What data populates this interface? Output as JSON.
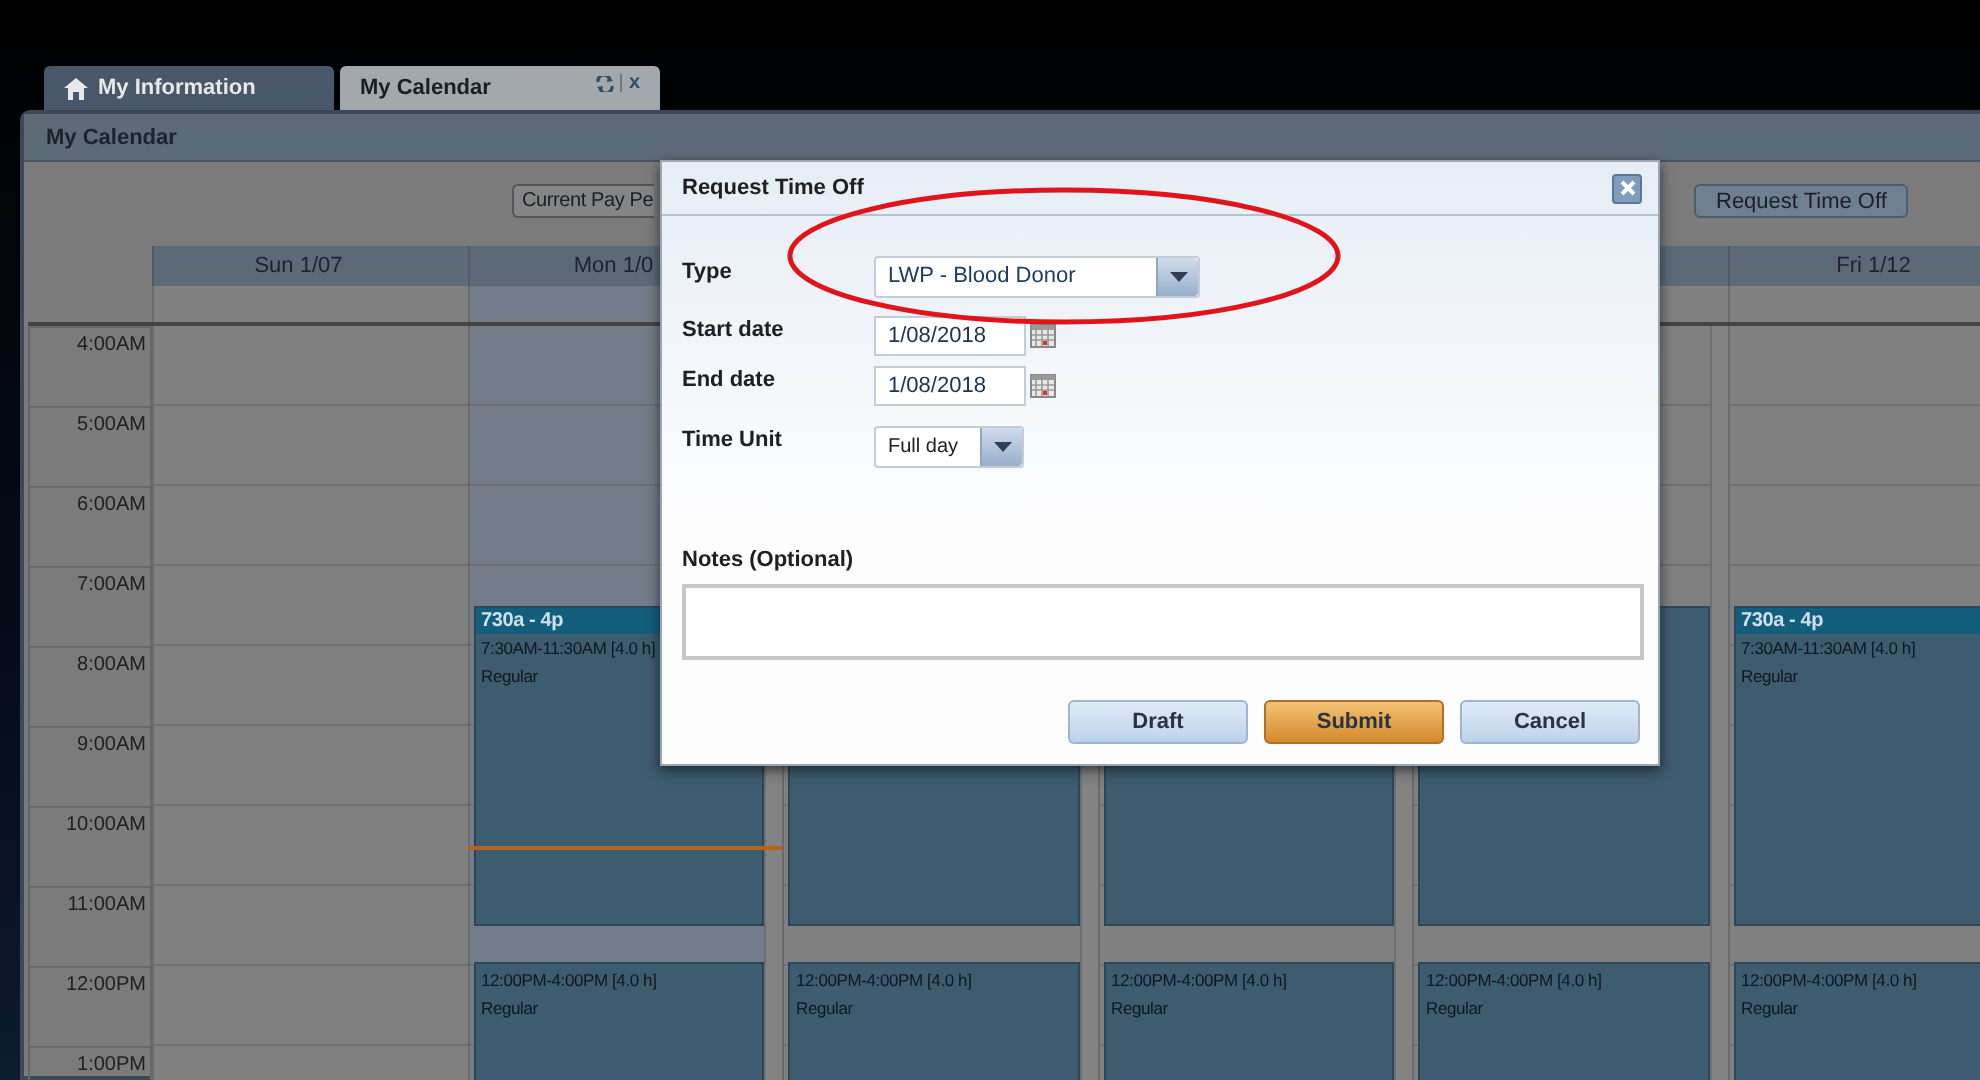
{
  "tabs": [
    {
      "label": "My Information",
      "selected": false
    },
    {
      "label": "My Calendar",
      "selected": true,
      "close": "x"
    }
  ],
  "panel": {
    "title": "My Calendar"
  },
  "toolbar": {
    "period_button": "Current Pay Pe",
    "request_button": "Request Time Off"
  },
  "calendar": {
    "hours": [
      "4:00AM",
      "5:00AM",
      "6:00AM",
      "7:00AM",
      "8:00AM",
      "9:00AM",
      "10:00AM",
      "11:00AM",
      "12:00PM",
      "1:00PM"
    ],
    "days": [
      {
        "label": "Sun 1/07",
        "today": false
      },
      {
        "label": "Mon 1/0",
        "today": true,
        "events": [
          {
            "kind": "morning",
            "title": "730a - 4p",
            "time": "7:30AM-11:30AM [4.0 h]",
            "label": "Regular"
          },
          {
            "kind": "afternoon",
            "time": "12:00PM-4:00PM [4.0 h]",
            "label": "Regular"
          }
        ]
      },
      {
        "today": false,
        "events": [
          {
            "kind": "morning"
          },
          {
            "kind": "afternoon",
            "time": "12:00PM-4:00PM [4.0 h]",
            "label": "Regular"
          }
        ]
      },
      {
        "today": false,
        "events": [
          {
            "kind": "morning"
          },
          {
            "kind": "afternoon",
            "time": "12:00PM-4:00PM [4.0 h]",
            "label": "Regular"
          }
        ]
      },
      {
        "today": false,
        "events": [
          {
            "kind": "morning"
          },
          {
            "kind": "afternoon",
            "time": "12:00PM-4:00PM [4.0 h]",
            "label": "Regular"
          }
        ]
      },
      {
        "label": "Fri 1/12",
        "today": false,
        "events": [
          {
            "kind": "morning",
            "title": "730a - 4p",
            "time": "7:30AM-11:30AM [4.0 h]",
            "label": "Regular"
          },
          {
            "kind": "afternoon",
            "time": "12:00PM-4:00PM [4.0 h]",
            "label": "Regular"
          }
        ]
      }
    ]
  },
  "dialog": {
    "title": "Request Time Off",
    "fields": [
      {
        "kind": "select",
        "label": "Type",
        "value": "LWP - Blood Donor"
      },
      {
        "kind": "date",
        "label": "Start date",
        "value": "1/08/2018"
      },
      {
        "kind": "date",
        "label": "End date",
        "value": "1/08/2018"
      },
      {
        "kind": "select",
        "label": "Time Unit",
        "value": "Full day"
      }
    ],
    "notes_label": "Notes (Optional)",
    "buttons": [
      {
        "label": "Draft",
        "kind": "default"
      },
      {
        "label": "Submit",
        "kind": "primary"
      },
      {
        "label": "Cancel",
        "kind": "default"
      }
    ]
  }
}
